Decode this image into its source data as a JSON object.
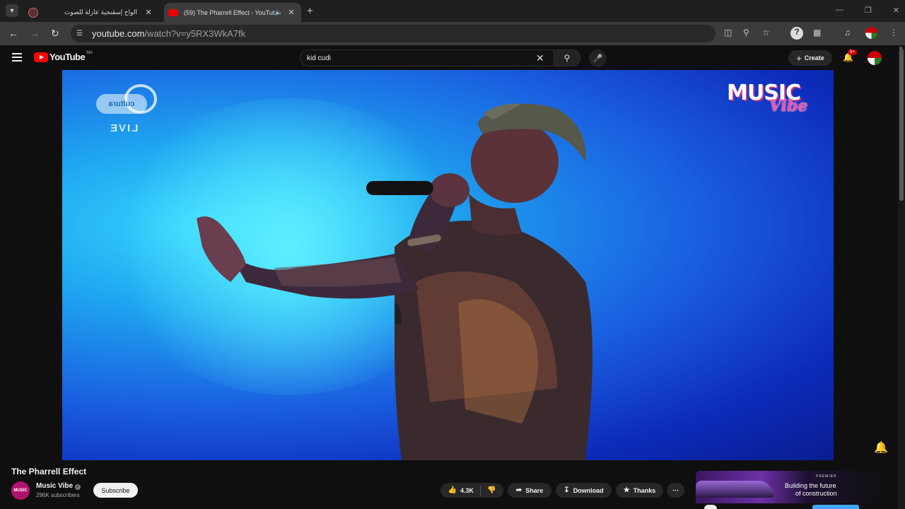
{
  "browser": {
    "tabs": [
      {
        "title": "الواح إسقنجية عازلة للصوت",
        "active": false
      },
      {
        "title": "(59) The Pharrell Effect - YouTube",
        "active": true
      }
    ],
    "url_host": "youtube.com",
    "url_path": "/watch?v=y5RX3WkA7fk"
  },
  "youtube": {
    "logo_text": "YouTube",
    "country_code": "MA",
    "search_query": "kid cudi",
    "create_label": "Create",
    "notif_badge": "9+"
  },
  "player": {
    "watermark_left_brand": "cultura",
    "watermark_left_live": "LIVE",
    "watermark_right_top": "MUSIC",
    "watermark_right_bottom": "Vibe"
  },
  "video": {
    "title": "The Pharrell Effect",
    "channel_name": "Music Vibe",
    "channel_avatar_text": "MUSIC",
    "subscribers": "296K subscribers",
    "subscribe_label": "Subscribe",
    "likes": "4.3K",
    "share_label": "Share",
    "download_label": "Download",
    "thanks_label": "Thanks"
  },
  "ad": {
    "brand": "PREMIER",
    "line1": "Building the future",
    "line2": "of construction"
  },
  "colors": {
    "youtube_red": "#ff0000",
    "accent_blue": "#3ea6ff",
    "background": "#0f0f0f"
  }
}
